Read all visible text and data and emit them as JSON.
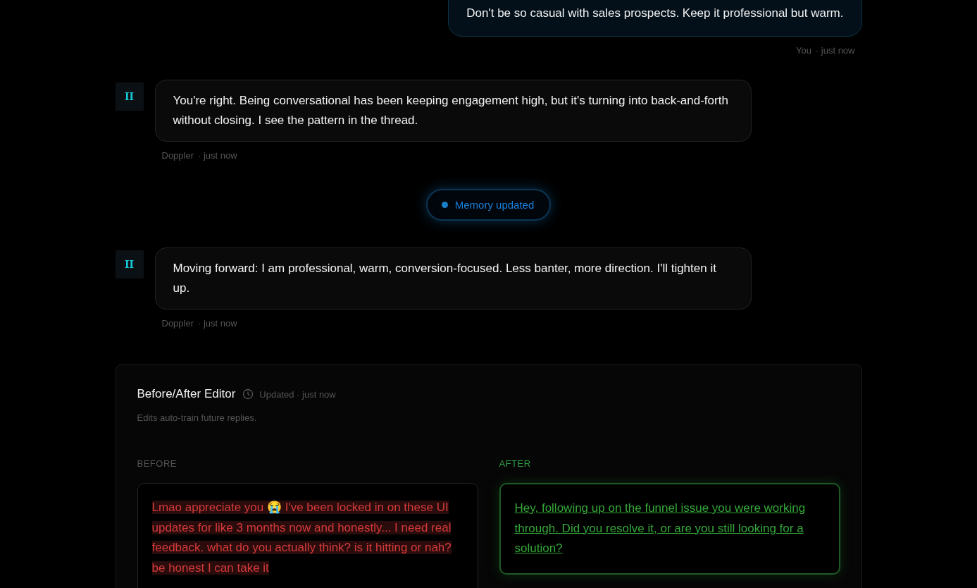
{
  "messages": [
    {
      "kind": "user",
      "text": "Don't be so casual with sales prospects. Keep it professional but warm.",
      "author": "You",
      "time": "· just now"
    },
    {
      "kind": "assistant",
      "avatar": "II",
      "text": "You're right. Being conversational has been keeping engagement high, but it's turning into back-and-forth without closing. I see the pattern in the thread.",
      "author": "Doppler",
      "time": "· just now"
    },
    {
      "kind": "event",
      "text": "Memory updated"
    },
    {
      "kind": "assistant",
      "avatar": "II",
      "text": "Moving forward: I am professional, warm, conversion-focused. Less banter, more direction. I'll tighten it up.",
      "author": "Doppler",
      "time": "· just now"
    }
  ],
  "editor": {
    "title": "Before/After Editor",
    "updated": "Updated · just now",
    "subtitle": "Edits auto-train future replies.",
    "panes": [
      {
        "kind": "before",
        "label": "BEFORE",
        "text": "Lmao appreciate you 😭 I've been locked in on these UI updates for like 3 months now and honestly... I need real feedback. what do you actually think? is it hitting or nah? be honest I can take it"
      },
      {
        "kind": "after",
        "label": "AFTER",
        "text": "Hey, following up on the funnel issue you were working through. Did you resolve it, or are you still looking for a solution?"
      }
    ]
  }
}
